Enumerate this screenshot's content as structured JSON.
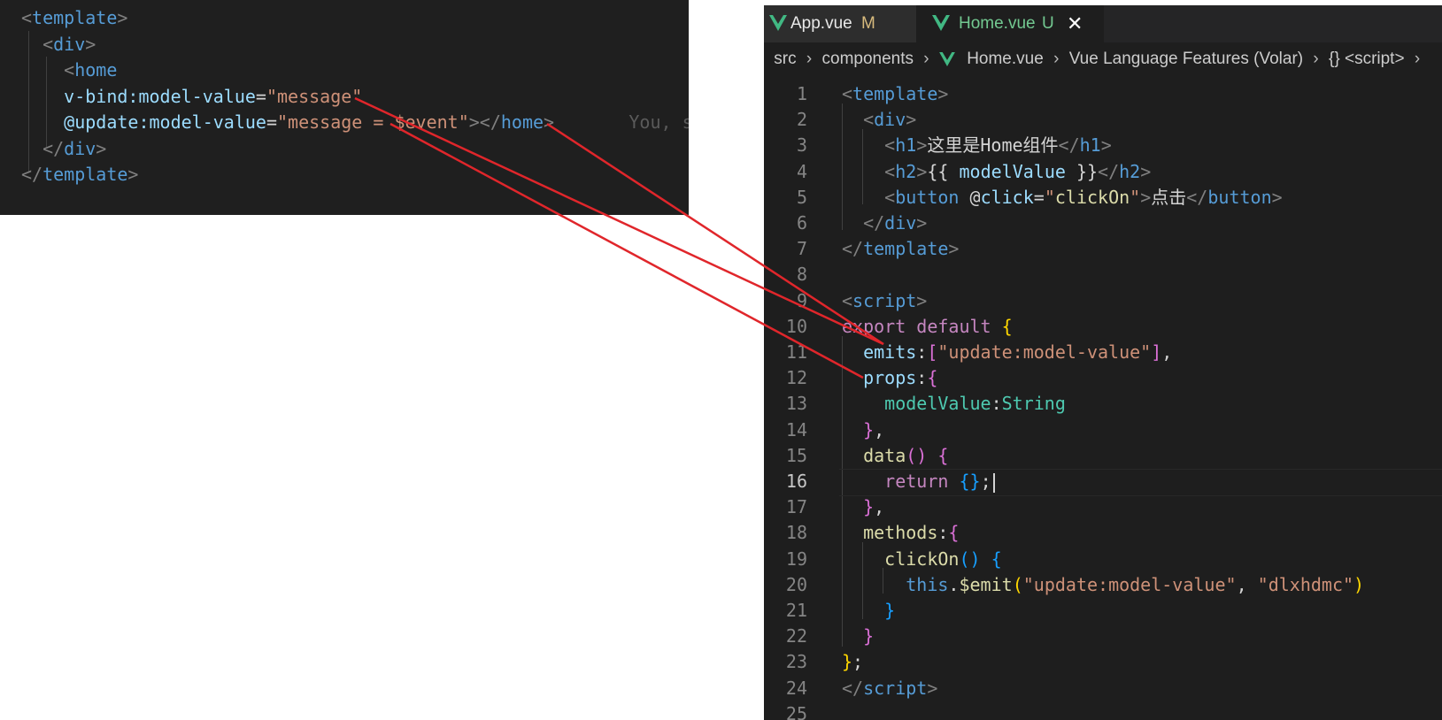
{
  "left_snippet": {
    "lines": [
      [
        {
          "c": "t-punc",
          "t": "<"
        },
        {
          "c": "t-tag",
          "t": "template"
        },
        {
          "c": "t-punc",
          "t": ">"
        }
      ],
      [
        {
          "c": "t-punc",
          "t": "  <"
        },
        {
          "c": "t-tag",
          "t": "div"
        },
        {
          "c": "t-punc",
          "t": ">"
        }
      ],
      [
        {
          "c": "t-punc",
          "t": "    <"
        },
        {
          "c": "t-tag",
          "t": "home"
        }
      ],
      [
        {
          "c": "t-attr",
          "t": "    v-bind:model-value"
        },
        {
          "c": "t-text",
          "t": "="
        },
        {
          "c": "t-str",
          "t": "\"message\""
        }
      ],
      [
        {
          "c": "t-attr",
          "t": "    @update:model-value"
        },
        {
          "c": "t-text",
          "t": "="
        },
        {
          "c": "t-str",
          "t": "\"message = $event\""
        },
        {
          "c": "t-punc",
          "t": "></"
        },
        {
          "c": "t-tag",
          "t": "home"
        },
        {
          "c": "t-punc",
          "t": ">"
        },
        {
          "c": "hint",
          "t": "       You, s"
        }
      ],
      [
        {
          "c": "t-punc",
          "t": "  </"
        },
        {
          "c": "t-tag",
          "t": "div"
        },
        {
          "c": "t-punc",
          "t": ">"
        }
      ],
      [
        {
          "c": "t-punc",
          "t": "</"
        },
        {
          "c": "t-tag",
          "t": "template"
        },
        {
          "c": "t-punc",
          "t": ">"
        }
      ]
    ]
  },
  "tabs": [
    {
      "label": "App.vue",
      "badge": "M"
    },
    {
      "label": "Home.vue",
      "badge": "U",
      "close": "✕"
    }
  ],
  "breadcrumb": {
    "items": [
      "src",
      "components",
      "Home.vue",
      "Vue Language Features (Volar)",
      "{} <script>"
    ],
    "separator": "›"
  },
  "editor": {
    "active_line": 16,
    "lines": [
      {
        "n": "1",
        "tokens": [
          {
            "c": "t-punc",
            "t": "<"
          },
          {
            "c": "t-tag",
            "t": "template"
          },
          {
            "c": "t-punc",
            "t": ">"
          }
        ]
      },
      {
        "n": "2",
        "tokens": [
          {
            "c": "t-punc",
            "t": "  <"
          },
          {
            "c": "t-tag",
            "t": "div"
          },
          {
            "c": "t-punc",
            "t": ">"
          }
        ]
      },
      {
        "n": "3",
        "tokens": [
          {
            "c": "t-punc",
            "t": "    <"
          },
          {
            "c": "t-tag",
            "t": "h1"
          },
          {
            "c": "t-punc",
            "t": ">"
          },
          {
            "c": "t-text",
            "t": "这里是Home组件"
          },
          {
            "c": "t-punc",
            "t": "</"
          },
          {
            "c": "t-tag",
            "t": "h1"
          },
          {
            "c": "t-punc",
            "t": ">"
          }
        ]
      },
      {
        "n": "4",
        "tokens": [
          {
            "c": "t-punc",
            "t": "    <"
          },
          {
            "c": "t-tag",
            "t": "h2"
          },
          {
            "c": "t-punc",
            "t": ">"
          },
          {
            "c": "t-text",
            "t": "{{ "
          },
          {
            "c": "t-attr",
            "t": "modelValue"
          },
          {
            "c": "t-text",
            "t": " }}"
          },
          {
            "c": "t-punc",
            "t": "</"
          },
          {
            "c": "t-tag",
            "t": "h2"
          },
          {
            "c": "t-punc",
            "t": ">"
          }
        ]
      },
      {
        "n": "5",
        "tokens": [
          {
            "c": "t-punc",
            "t": "    <"
          },
          {
            "c": "t-tag",
            "t": "button"
          },
          {
            "c": "t-text",
            "t": " @"
          },
          {
            "c": "t-attr",
            "t": "click"
          },
          {
            "c": "t-text",
            "t": "="
          },
          {
            "c": "t-str",
            "t": "\""
          },
          {
            "c": "t-func",
            "t": "clickOn"
          },
          {
            "c": "t-str",
            "t": "\""
          },
          {
            "c": "t-punc",
            "t": ">"
          },
          {
            "c": "t-text",
            "t": "点击"
          },
          {
            "c": "t-punc",
            "t": "</"
          },
          {
            "c": "t-tag",
            "t": "button"
          },
          {
            "c": "t-punc",
            "t": ">"
          }
        ]
      },
      {
        "n": "6",
        "tokens": [
          {
            "c": "t-punc",
            "t": "  </"
          },
          {
            "c": "t-tag",
            "t": "div"
          },
          {
            "c": "t-punc",
            "t": ">"
          }
        ]
      },
      {
        "n": "7",
        "tokens": [
          {
            "c": "t-punc",
            "t": "</"
          },
          {
            "c": "t-tag",
            "t": "template"
          },
          {
            "c": "t-punc",
            "t": ">"
          }
        ]
      },
      {
        "n": "8",
        "tokens": []
      },
      {
        "n": "9",
        "tokens": [
          {
            "c": "t-punc",
            "t": "<"
          },
          {
            "c": "t-tag",
            "t": "script"
          },
          {
            "c": "t-punc",
            "t": ">"
          }
        ]
      },
      {
        "n": "10",
        "tokens": [
          {
            "c": "t-kw",
            "t": "export"
          },
          {
            "c": "t-text",
            "t": " "
          },
          {
            "c": "t-kw",
            "t": "default"
          },
          {
            "c": "t-text",
            "t": " "
          },
          {
            "c": "t-brace1",
            "t": "{"
          }
        ]
      },
      {
        "n": "11",
        "tokens": [
          {
            "c": "t-prop",
            "t": "  emits"
          },
          {
            "c": "t-text",
            "t": ":"
          },
          {
            "c": "t-brace2",
            "t": "["
          },
          {
            "c": "t-str",
            "t": "\"update:model-value\""
          },
          {
            "c": "t-brace2",
            "t": "]"
          },
          {
            "c": "t-text",
            "t": ","
          }
        ]
      },
      {
        "n": "12",
        "tokens": [
          {
            "c": "t-prop",
            "t": "  props"
          },
          {
            "c": "t-text",
            "t": ":"
          },
          {
            "c": "t-brace2",
            "t": "{"
          }
        ]
      },
      {
        "n": "13",
        "tokens": [
          {
            "c": "t-type",
            "t": "    modelValue"
          },
          {
            "c": "t-text",
            "t": ":"
          },
          {
            "c": "t-type",
            "t": "String"
          }
        ]
      },
      {
        "n": "14",
        "tokens": [
          {
            "c": "t-brace2",
            "t": "  }"
          },
          {
            "c": "t-text",
            "t": ","
          }
        ]
      },
      {
        "n": "15",
        "tokens": [
          {
            "c": "t-func",
            "t": "  data"
          },
          {
            "c": "t-brace2",
            "t": "()"
          },
          {
            "c": "t-text",
            "t": " "
          },
          {
            "c": "t-brace2",
            "t": "{"
          }
        ]
      },
      {
        "n": "16",
        "tokens": [
          {
            "c": "t-kw",
            "t": "    return"
          },
          {
            "c": "t-text",
            "t": " "
          },
          {
            "c": "t-brace3",
            "t": "{}"
          },
          {
            "c": "t-text",
            "t": ";"
          }
        ]
      },
      {
        "n": "17",
        "tokens": [
          {
            "c": "t-brace2",
            "t": "  }"
          },
          {
            "c": "t-text",
            "t": ","
          }
        ]
      },
      {
        "n": "18",
        "tokens": [
          {
            "c": "t-func",
            "t": "  methods"
          },
          {
            "c": "t-text",
            "t": ":"
          },
          {
            "c": "t-brace2",
            "t": "{"
          }
        ]
      },
      {
        "n": "19",
        "tokens": [
          {
            "c": "t-func",
            "t": "    clickOn"
          },
          {
            "c": "t-brace3",
            "t": "()"
          },
          {
            "c": "t-text",
            "t": " "
          },
          {
            "c": "t-brace3",
            "t": "{"
          }
        ]
      },
      {
        "n": "20",
        "tokens": [
          {
            "c": "t-kw2",
            "t": "      this"
          },
          {
            "c": "t-text",
            "t": "."
          },
          {
            "c": "t-func",
            "t": "$emit"
          },
          {
            "c": "t-brace1",
            "t": "("
          },
          {
            "c": "t-str",
            "t": "\"update:model-value\""
          },
          {
            "c": "t-text",
            "t": ", "
          },
          {
            "c": "t-str",
            "t": "\"dlxhdmc\""
          },
          {
            "c": "t-brace1",
            "t": ")"
          }
        ]
      },
      {
        "n": "21",
        "tokens": [
          {
            "c": "t-brace3",
            "t": "    }"
          }
        ]
      },
      {
        "n": "22",
        "tokens": [
          {
            "c": "t-brace2",
            "t": "  }"
          }
        ]
      },
      {
        "n": "23",
        "tokens": [
          {
            "c": "t-brace1",
            "t": "}"
          },
          {
            "c": "t-text",
            "t": ";"
          }
        ]
      },
      {
        "n": "24",
        "tokens": [
          {
            "c": "t-punc",
            "t": "</"
          },
          {
            "c": "t-tag",
            "t": "script"
          },
          {
            "c": "t-punc",
            "t": ">"
          }
        ]
      },
      {
        "n": "25",
        "tokens": []
      }
    ]
  },
  "colors": {
    "arrow": "#e0262b",
    "vue_green": "#41b883"
  }
}
